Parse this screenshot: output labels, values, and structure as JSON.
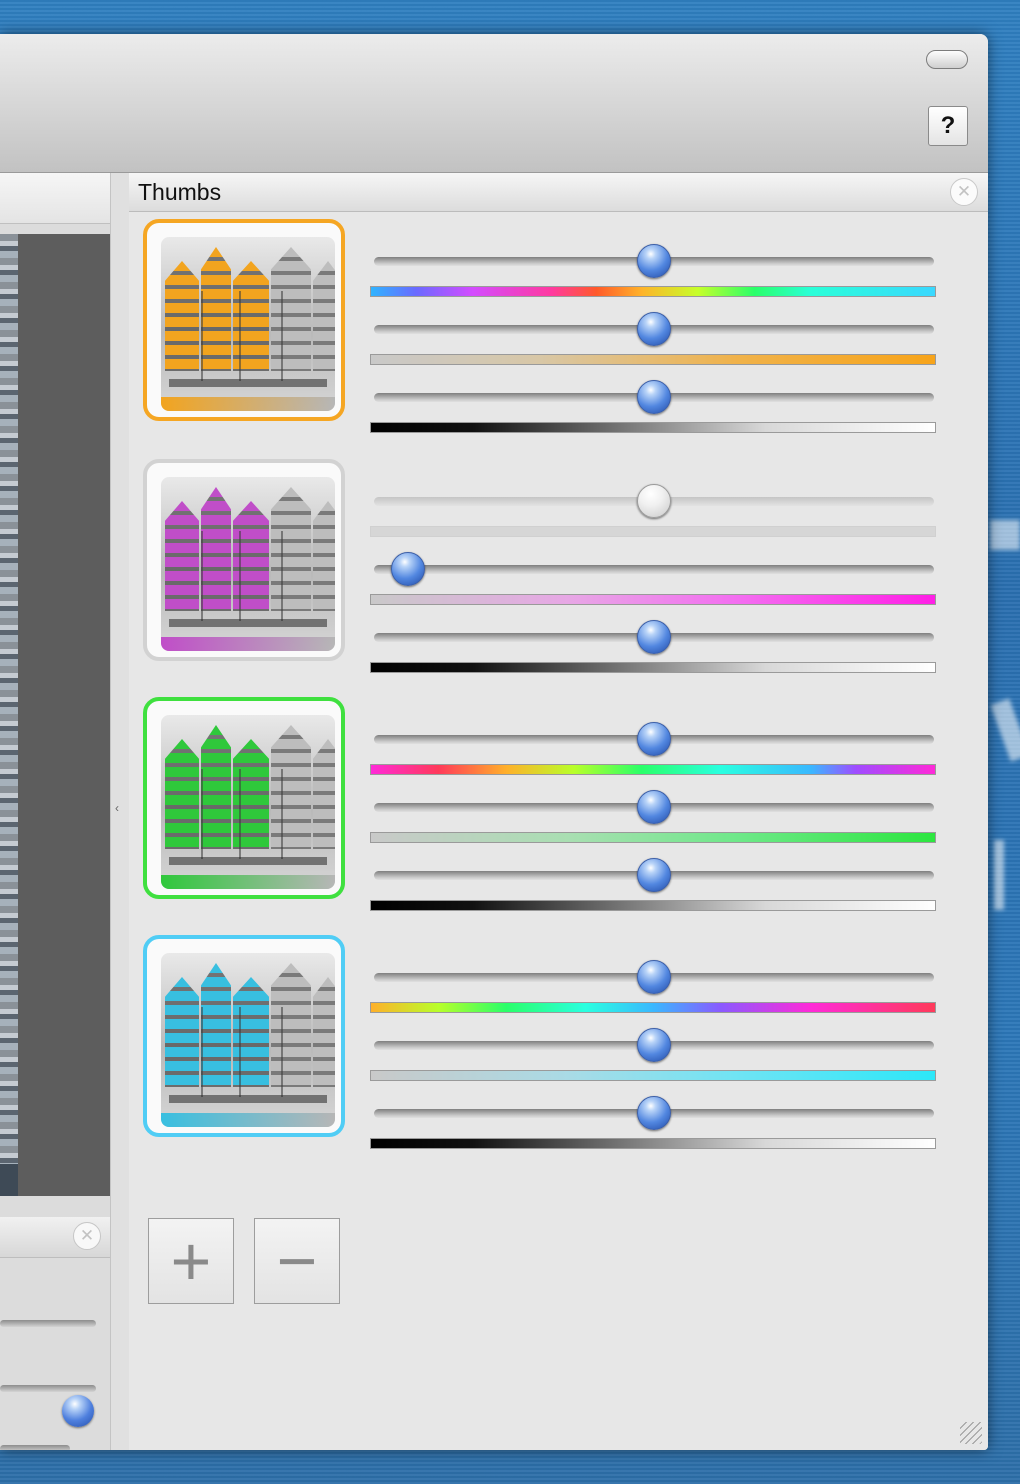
{
  "window": {
    "help_label": "?"
  },
  "left_pane": {
    "close_icon": "✕"
  },
  "panel": {
    "title": "Thumbs",
    "close_icon": "✕"
  },
  "thumbs": [
    {
      "name": "thumb-orange",
      "border": "#f5a623",
      "tint": "#f2a41f",
      "sliders": [
        0.5,
        0.5,
        0.5
      ],
      "disabled_first": false,
      "bars": [
        "hue",
        "orange",
        "lum"
      ]
    },
    {
      "name": "thumb-magenta",
      "border": "#d2d2d2",
      "tint": "#c04ec8",
      "sliders": [
        0.5,
        0.03,
        0.5
      ],
      "disabled_first": true,
      "bars": [
        "none",
        "magenta",
        "lum"
      ]
    },
    {
      "name": "thumb-green",
      "border": "#3fe03f",
      "tint": "#2fc83b",
      "sliders": [
        0.5,
        0.5,
        0.5
      ],
      "disabled_first": false,
      "bars": [
        "hue2",
        "green",
        "lum"
      ]
    },
    {
      "name": "thumb-cyan",
      "border": "#50cdf5",
      "tint": "#38bfe0",
      "sliders": [
        0.5,
        0.5,
        0.5
      ],
      "disabled_first": false,
      "bars": [
        "hue3",
        "cyan",
        "lum"
      ]
    }
  ],
  "buttons": {
    "add": "+",
    "remove": "−"
  },
  "colors": {
    "accent_orange": "#f5a623",
    "accent_green": "#3fe03f",
    "accent_cyan": "#50cdf5",
    "knob_blue": "#4f80de"
  },
  "icons": {
    "zoom_button": "pill-icon",
    "help": "question-icon",
    "close": "close-icon",
    "add": "plus-icon",
    "remove": "minus-icon",
    "resize": "resize-grip-icon"
  }
}
